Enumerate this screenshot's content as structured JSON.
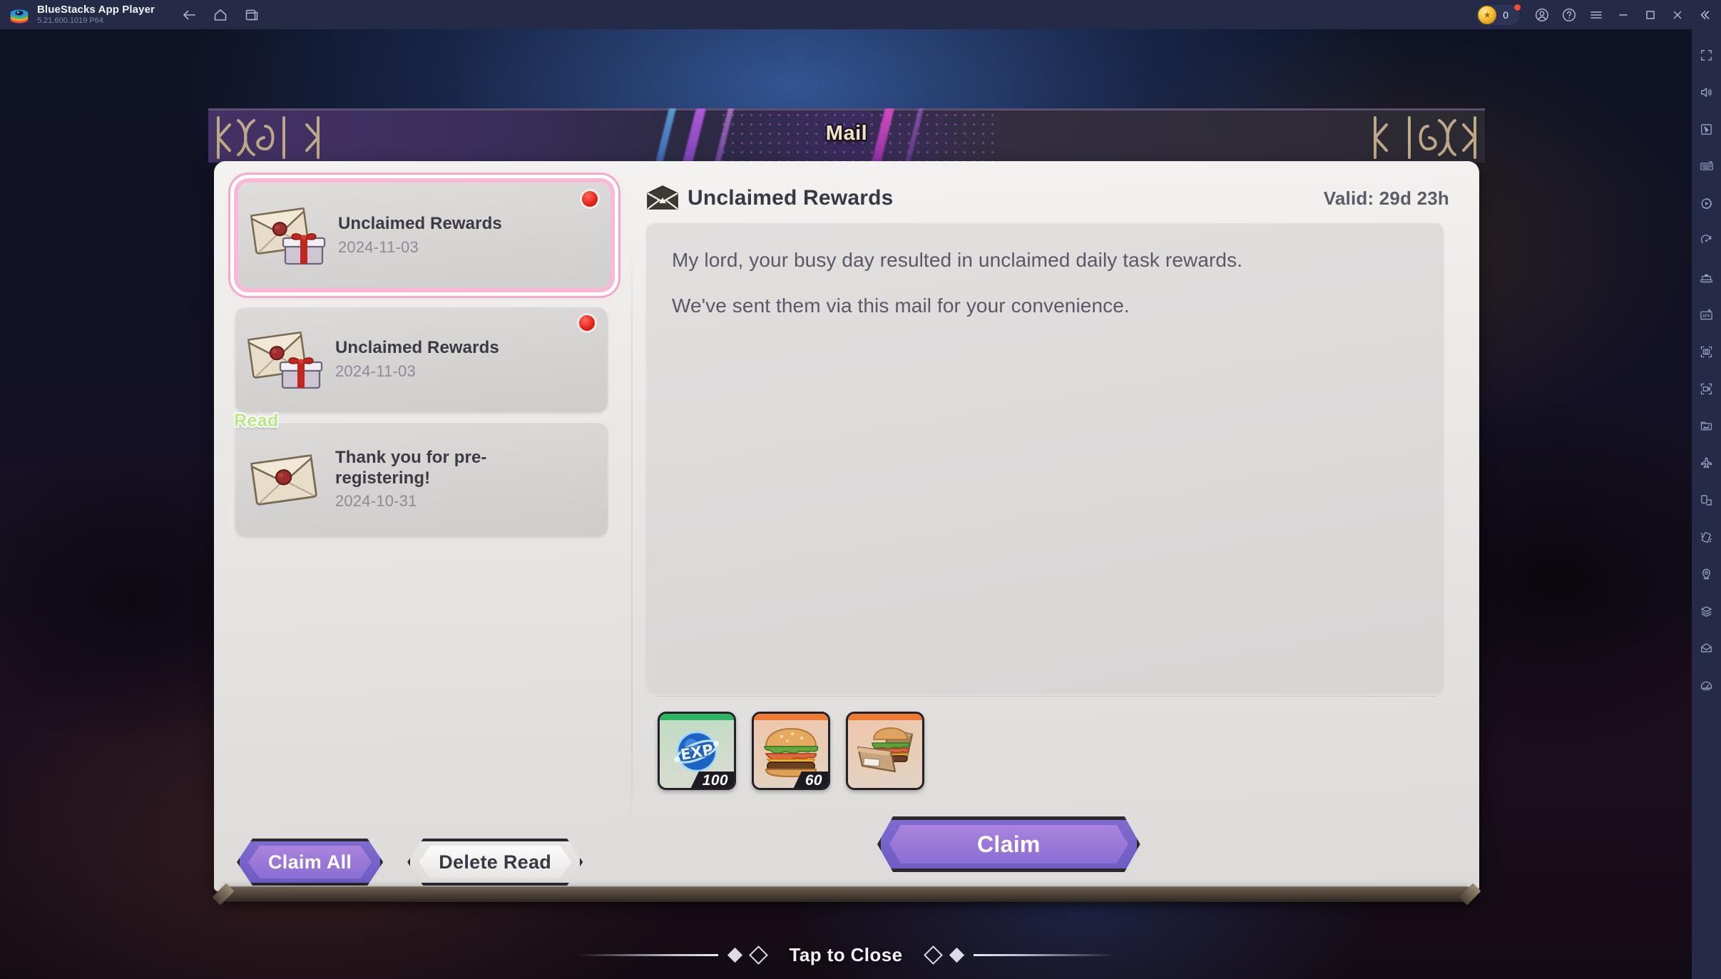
{
  "app": {
    "name": "BlueStacks App Player",
    "version": "5.21.600.1019  P64",
    "nav": [
      {
        "name": "back",
        "label": "Back"
      },
      {
        "name": "home",
        "label": "Home"
      },
      {
        "name": "multi-instance",
        "label": "Multi-instance"
      }
    ],
    "points": {
      "value": "0",
      "icon": "coin-icon",
      "has_badge": true
    },
    "window_controls": [
      {
        "name": "account-icon",
        "label": "Account"
      },
      {
        "name": "help-icon",
        "label": "Help"
      },
      {
        "name": "menu-icon",
        "label": "Menu"
      },
      {
        "name": "minimize-icon",
        "label": "Minimize"
      },
      {
        "name": "maximize-icon",
        "label": "Maximize"
      },
      {
        "name": "close-icon",
        "label": "Close"
      },
      {
        "name": "collapse-sidebar-icon",
        "label": "Collapse"
      }
    ],
    "sidebar_tools": [
      {
        "name": "fullscreen-icon",
        "label": "Full screen"
      },
      {
        "name": "volume-icon",
        "label": "Volume"
      },
      {
        "name": "cursor-controls-icon",
        "label": "Game controls"
      },
      {
        "name": "keyboard-icon",
        "label": "Keymapping"
      },
      {
        "name": "macro-record-icon",
        "label": "Macro recorder"
      },
      {
        "name": "rotate-icon",
        "label": "Rotate"
      },
      {
        "name": "eco-mode-icon",
        "label": "Eco mode"
      },
      {
        "name": "install-apk-icon",
        "label": "Install APK"
      },
      {
        "name": "screenshot-icon",
        "label": "Screenshot"
      },
      {
        "name": "record-screen-icon",
        "label": "Record screen"
      },
      {
        "name": "media-manager-icon",
        "label": "Media manager"
      },
      {
        "name": "airplane-icon",
        "label": "Trim memory"
      },
      {
        "name": "multi-window-icon",
        "label": "Multi window"
      },
      {
        "name": "shake-icon",
        "label": "Shake"
      },
      {
        "name": "location-icon",
        "label": "Location"
      },
      {
        "name": "layers-icon",
        "label": "Layers"
      },
      {
        "name": "mail-icon",
        "label": "Mail"
      },
      {
        "name": "performance-icon",
        "label": "Performance"
      }
    ]
  },
  "dialog": {
    "title": "Mail",
    "mail_list": [
      {
        "title": "Unclaimed Rewards",
        "date": "2024-11-03",
        "selected": true,
        "unread_dot": true,
        "read_badge": null,
        "icon": "letter-with-gift-icon"
      },
      {
        "title": "Unclaimed Rewards",
        "date": "2024-11-03",
        "selected": false,
        "unread_dot": true,
        "read_badge": null,
        "icon": "letter-with-gift-icon"
      },
      {
        "title": "Thank you for pre-registering!",
        "date": "2024-10-31",
        "selected": false,
        "unread_dot": false,
        "read_badge": "Read",
        "icon": "sealed-letter-icon"
      }
    ],
    "left_buttons": [
      {
        "name": "claim-all-button",
        "label": "Claim All",
        "style": "purple"
      },
      {
        "name": "delete-read-button",
        "label": "Delete Read",
        "style": "white"
      }
    ],
    "detail": {
      "icon": "envelope-icon",
      "title": "Unclaimed Rewards",
      "valid": "Valid: 29d 23h",
      "body_lines": [
        "My lord, your busy day resulted in unclaimed daily task rewards.",
        "We've sent them via this mail for your convenience."
      ],
      "rewards": [
        {
          "name": "exp-orb",
          "qty": "100",
          "rarity": "green",
          "art": "exp-orb-icon"
        },
        {
          "name": "burger",
          "qty": "60",
          "rarity": "orange",
          "art": "burger-icon"
        },
        {
          "name": "burger-box",
          "qty": "",
          "rarity": "orange",
          "art": "burger-box-icon"
        }
      ],
      "claim_button": {
        "name": "claim-button",
        "label": "Claim"
      }
    }
  },
  "footer": {
    "tap_to_close": "Tap to Close"
  },
  "colors": {
    "accent_purple": "#9b78d8",
    "banner_gold": "#f3e2c4",
    "selected_outline_pink": "#f3a8cd",
    "unread_red": "#e7251c",
    "read_green": "#b8e986",
    "rarity_green": "#2eb561",
    "rarity_orange": "#ef7a35",
    "bluestacks_navy": "#252a47"
  }
}
